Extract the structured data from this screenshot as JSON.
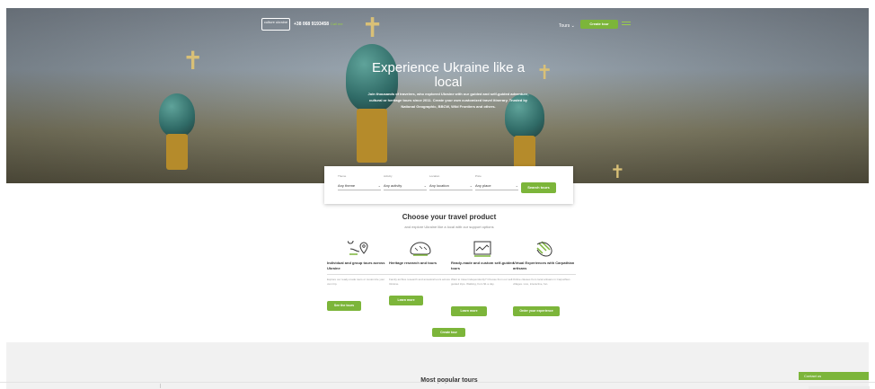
{
  "header": {
    "logo_text": "culture ukraine",
    "phone": "+38 068 9193458",
    "callback_label": "Call me",
    "tours_menu_label": "Tours",
    "create_tour_label": "Create tour"
  },
  "hero": {
    "title": "Experience Ukraine like a local",
    "subtitle": "Join thousands of travelers, who explored Ukraine with our guided and self-guided adventure, cultural or heritage tours since 2011. Create your own customized travel itinerary. Trusted by National Geographic, BBCW, Wild Frontiers and others."
  },
  "search": {
    "theme": {
      "label": "Theme",
      "value": "Any theme"
    },
    "activity": {
      "label": "Activity",
      "value": "Any activity"
    },
    "location": {
      "label": "Location",
      "value": "Any location"
    },
    "price": {
      "label": "Price",
      "value": "Any place"
    },
    "button_label": "Search tours"
  },
  "products": {
    "title": "Choose your travel product",
    "subtitle": "and explore Ukraine like a local with our support options",
    "cards": [
      {
        "icon": "route-pin-icon",
        "title": "Individual and group tours across Ukraine",
        "desc": "Explore our ready-made tours or customize your own trip.",
        "button": "See the tours"
      },
      {
        "icon": "bread-icon",
        "title": "Heritage research and tours",
        "desc": "Family archive research and ancestral tours across Ukraine.",
        "button": "Learn more"
      },
      {
        "icon": "map-chart-icon",
        "title": "Ready-made and custom self-guided tours",
        "desc": "Want to travel independently? Choose from our self-guided trips. Walking, from $1 a day.",
        "button": "Learn more"
      },
      {
        "icon": "hand-leaf-icon",
        "title": "Virtual Experiences with Carpathian artisans",
        "desc": "Online classes from local artisans in Carpathian villages. Live, interactive, fun.",
        "button": "Order your experience"
      }
    ],
    "create_tour_label": "Create tour"
  },
  "popular": {
    "title": "Most popular tours"
  },
  "widget": {
    "contact_label": "Contact us"
  },
  "colors": {
    "accent": "#7cb53a"
  }
}
